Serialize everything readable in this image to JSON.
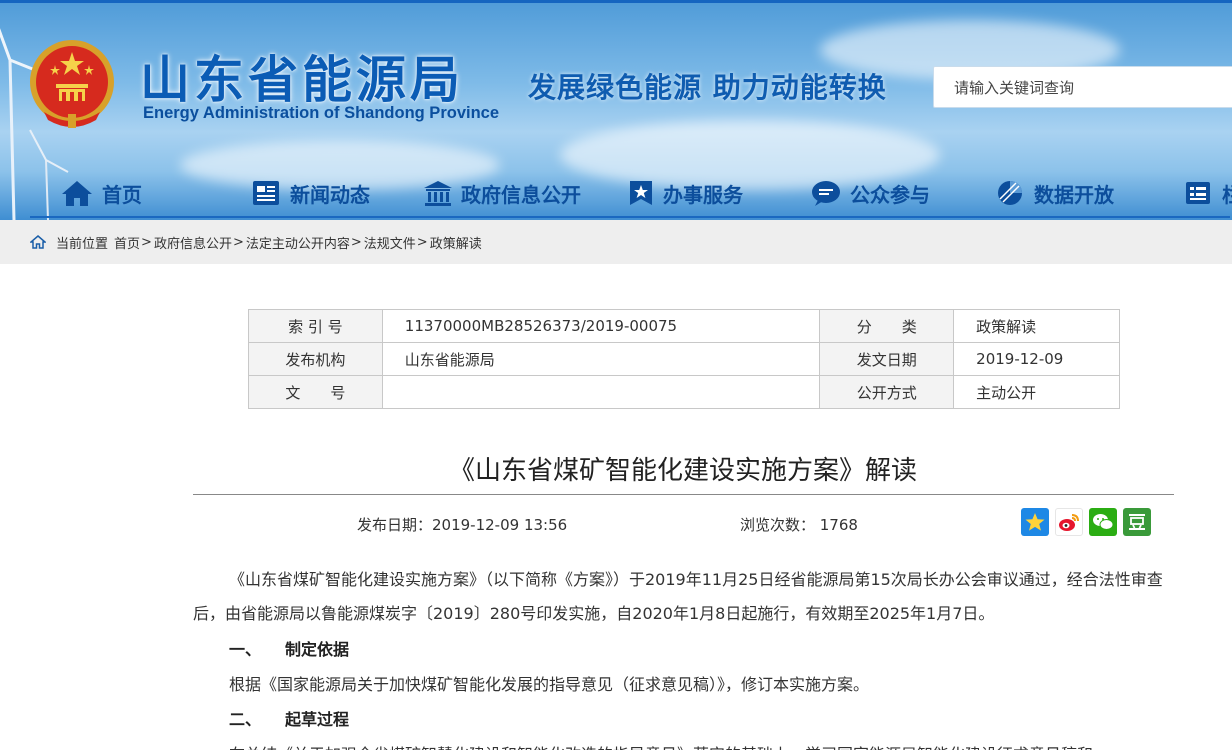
{
  "header": {
    "title": "山东省能源局",
    "subtitle": "Energy Administration of Shandong Province",
    "slogan": "发展绿色能源 助力动能转换",
    "search_placeholder": "请输入关键词查询",
    "accent_color": "#0b5cb5"
  },
  "nav": {
    "items": [
      {
        "label": "首页",
        "icon": "home-icon"
      },
      {
        "label": "新闻动态",
        "icon": "news-icon"
      },
      {
        "label": "政府信息公开",
        "icon": "government-building-icon"
      },
      {
        "label": "办事服务",
        "icon": "service-star-icon"
      },
      {
        "label": "公众参与",
        "icon": "chat-bubble-icon"
      },
      {
        "label": "数据开放",
        "icon": "pie-chart-icon"
      },
      {
        "label": "栏",
        "icon": "column-icon"
      }
    ]
  },
  "breadcrumb": {
    "prefix": "当前位置",
    "items": [
      "首页",
      "政府信息公开",
      "法定主动公开内容",
      "法规文件",
      "政策解读"
    ]
  },
  "meta": {
    "index_label": "索 引 号",
    "index_value": "11370000MB28526373/2019-00075",
    "category_label": "分　　类",
    "category_value": "政策解读",
    "publisher_label": "发布机构",
    "publisher_value": "山东省能源局",
    "issue_date_label": "发文日期",
    "issue_date_value": "2019-12-09",
    "doc_no_label": "文　　号",
    "doc_no_value": "",
    "disclosure_label": "公开方式",
    "disclosure_value": "主动公开"
  },
  "article": {
    "title": "《山东省煤矿智能化建设实施方案》解读",
    "publish_date": "发布日期：2019-12-09 13:56",
    "views": "浏览次数： 1768",
    "para1": "《山东省煤矿智能化建设实施方案》（以下简称《方案》）于2019年11月25日经省能源局第15次局长办公会审议通过，经合法性审查后，由省能源局以鲁能源煤炭字〔2019〕280号印发实施，自2020年1月8日起施行，有效期至2025年1月7日。",
    "sec1_num": "一、",
    "sec1_title": "制定依据",
    "para2": "根据《国家能源局关于加快煤矿智能化发展的指导意见（征求意见稿）》，修订本实施方案。",
    "sec2_num": "二、",
    "sec2_title": "起草过程",
    "para3": "在总结《关于加强全省煤矿智慧化建设和智能化改造的指导意见》落实的基础上，学习国家能源局智能化建设征求意见稿和"
  },
  "share": {
    "icons": [
      "favorite-star-icon",
      "weibo-icon",
      "wechat-icon",
      "douban-icon"
    ]
  }
}
